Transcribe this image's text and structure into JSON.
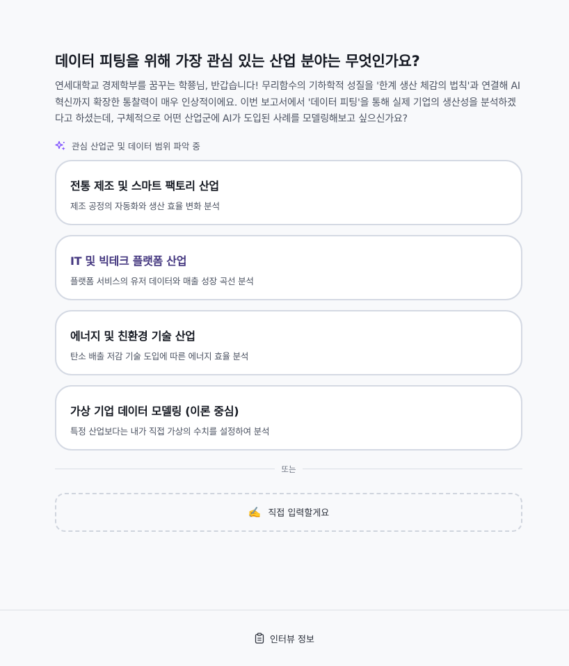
{
  "question": {
    "title": "데이터 피팅을 위해 가장 관심 있는 산업 분야는 무엇인가요?",
    "description": "연세대학교 경제학부를 꿈꾸는 학쭁님, 반갑습니다! 무리함수의 기하학적 성질을 '한계 생산 체감의 법칙'과 연결해 AI 혁신까지 확장한 통찰력이 매우 인상적이에요. 이번 보고서에서 '데이터 피팅'을 통해 실제 기업의 생산성을 분석하겠다고 하셨는데, 구체적으로 어떤 산업군에 AI가 도입된 사례를 모델링해보고 싶으신가요?"
  },
  "status": {
    "icon": "sparkle-icon",
    "text": "관심 산업군 및 데이터 범위 파악 중",
    "color": "#7c4dff"
  },
  "options": [
    {
      "title": "전통 제조 및 스마트 팩토리 산업",
      "subtitle": "제조 공정의 자동화와 생산 효율 변화 분석"
    },
    {
      "title": "IT 및 빅테크 플랫폼 산업",
      "subtitle": "플랫폼 서비스의 유저 데이터와 매출 성장 곡선 분석"
    },
    {
      "title": "에너지 및 친환경 기술 산업",
      "subtitle": "탄소 배출 저감 기술 도입에 따른 에너지 효율 분석"
    },
    {
      "title": "가상 기업 데이터 모델링 (이론 중심)",
      "subtitle": "특정 산업보다는 내가 직접 가상의 수치를 설정하여 분석"
    }
  ],
  "divider": {
    "label": "또는"
  },
  "direct_input": {
    "icon": "writing-hand-icon",
    "glyph": "✍️",
    "label": "직접 입력할게요"
  },
  "footer": {
    "icon": "clipboard-icon",
    "label": "인터뷰 정보"
  },
  "colors": {
    "accent_title": "#43367f",
    "card_border": "#d4d9e3",
    "background": "#f8f9fb"
  }
}
